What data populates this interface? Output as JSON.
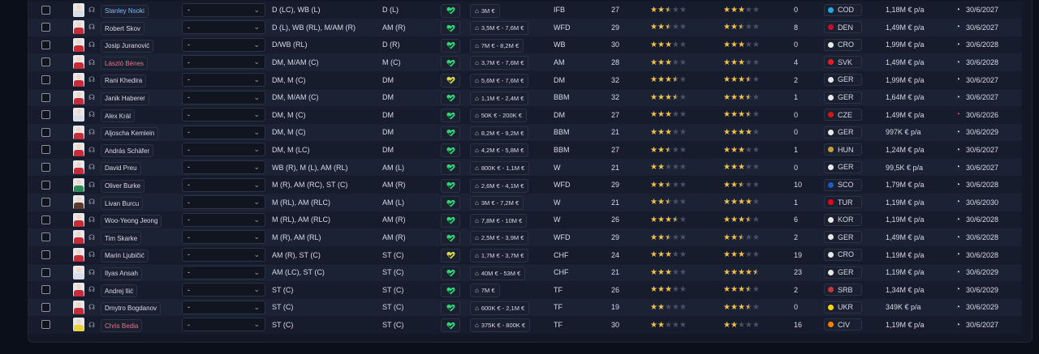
{
  "colors": {
    "background": "#0b0f1a",
    "panel": "#131826",
    "star": "#f2c14e",
    "heart": "#2ed573",
    "heart_alt": "#d6d94a",
    "contract_warning": "#e34a57"
  },
  "icons": {
    "agent": "headset-icon",
    "value": "price-tag-icon",
    "interest": "heart-icon",
    "contract": "clock-icon",
    "selection": "checkbox",
    "dropdown": "chevron-down-icon"
  },
  "rows": [
    {
      "name": "Stanley Nsoki",
      "name_color": "blue",
      "shirt": "#d8dde6",
      "select": "-",
      "positions": "D (LC), WB (L)",
      "position_short": "D (L)",
      "heart": "green",
      "value": "3M €",
      "role": "IFB",
      "age": "27",
      "rating_current": 2.5,
      "rating_potential": 3,
      "apps": "0",
      "nation": "COD",
      "nation_color": "#2aa6e0",
      "wage": "1,18M € p/a",
      "contract": "30/6/2027",
      "contract_warning": false
    },
    {
      "name": "Robert Skov",
      "name_color": "",
      "shirt": "#c92a3a",
      "select": "-",
      "positions": "D (L), WB (RL), M/AM (R)",
      "position_short": "AM (R)",
      "heart": "green",
      "value": "3,5M € - 7,6M €",
      "role": "WFD",
      "age": "29",
      "rating_current": 2.5,
      "rating_potential": 2.5,
      "apps": "8",
      "nation": "DEN",
      "nation_color": "#c8102e",
      "wage": "1,49M € p/a",
      "contract": "30/6/2027",
      "contract_warning": false
    },
    {
      "name": "Josip Juranović",
      "name_color": "",
      "shirt": "#c92a3a",
      "select": "-",
      "positions": "D/WB (RL)",
      "position_short": "D (R)",
      "heart": "green",
      "value": "7M € - 8,2M €",
      "role": "WB",
      "age": "30",
      "rating_current": 3,
      "rating_potential": 3,
      "apps": "0",
      "nation": "CRO",
      "nation_color": "#e8e8e8",
      "wage": "1,99M € p/a",
      "contract": "30/6/2028",
      "contract_warning": false
    },
    {
      "name": "László Bénes",
      "name_color": "red",
      "shirt": "#c92a3a",
      "select": "-",
      "positions": "DM, M/AM (C)",
      "position_short": "M (C)",
      "heart": "green",
      "value": "3,7M € - 7,6M €",
      "role": "AM",
      "age": "28",
      "rating_current": 3,
      "rating_potential": 3,
      "apps": "4",
      "nation": "SVK",
      "nation_color": "#ee1c25",
      "wage": "1,49M € p/a",
      "contract": "30/6/2028",
      "contract_warning": false
    },
    {
      "name": "Rani Khedira",
      "name_color": "",
      "shirt": "#c92a3a",
      "select": "-",
      "positions": "DM, M (C)",
      "position_short": "DM",
      "heart": "yellow",
      "value": "5,6M € - 7,6M €",
      "role": "DM",
      "age": "32",
      "rating_current": 3.5,
      "rating_potential": 3.5,
      "apps": "2",
      "nation": "GER",
      "nation_color": "#e8e8e8",
      "wage": "1,99M € p/a",
      "contract": "30/6/2027",
      "contract_warning": false
    },
    {
      "name": "Janik Haberer",
      "name_color": "",
      "shirt": "#c92a3a",
      "select": "-",
      "positions": "DM, M/AM (C)",
      "position_short": "DM",
      "heart": "green",
      "value": "1,1M € - 2,4M €",
      "role": "BBM",
      "age": "32",
      "rating_current": 3.5,
      "rating_potential": 3.5,
      "apps": "1",
      "nation": "GER",
      "nation_color": "#e8e8e8",
      "wage": "1,64M € p/a",
      "contract": "30/6/2027",
      "contract_warning": false
    },
    {
      "name": "Alex Král",
      "name_color": "",
      "shirt": "#d8dde6",
      "select": "-",
      "positions": "DM, M (C)",
      "position_short": "DM",
      "heart": "green",
      "value": "50K € - 200K €",
      "role": "DM",
      "age": "27",
      "rating_current": 3,
      "rating_potential": 3.5,
      "apps": "0",
      "nation": "CZE",
      "nation_color": "#d7141a",
      "wage": "1,49M € p/a",
      "contract": "30/6/2026",
      "contract_warning": true
    },
    {
      "name": "Aljoscha Kemlein",
      "name_color": "",
      "shirt": "#c92a3a",
      "select": "-",
      "positions": "DM, M (C)",
      "position_short": "DM",
      "heart": "green",
      "value": "8,2M € - 9,2M €",
      "role": "BBM",
      "age": "21",
      "rating_current": 3,
      "rating_potential": 4,
      "apps": "0",
      "nation": "GER",
      "nation_color": "#e8e8e8",
      "wage": "997K € p/a",
      "contract": "30/6/2029",
      "contract_warning": false
    },
    {
      "name": "András Schäfer",
      "name_color": "",
      "shirt": "#c92a3a",
      "select": "-",
      "positions": "DM, M (LC)",
      "position_short": "DM",
      "heart": "green",
      "value": "4,2M € - 5,8M €",
      "role": "BBM",
      "age": "27",
      "rating_current": 2.5,
      "rating_potential": 3,
      "apps": "1",
      "nation": "HUN",
      "nation_color": "#c0a040",
      "wage": "1,24M € p/a",
      "contract": "30/6/2027",
      "contract_warning": false
    },
    {
      "name": "David Preu",
      "name_color": "",
      "shirt": "#c92a3a",
      "select": "-",
      "positions": "WB (R), M (L), AM (RL)",
      "position_short": "AM (L)",
      "heart": "green",
      "value": "800K € - 1,1M €",
      "role": "W",
      "age": "21",
      "rating_current": 2,
      "rating_potential": 3,
      "apps": "0",
      "nation": "GER",
      "nation_color": "#e8e8e8",
      "wage": "99,5K € p/a",
      "contract": "30/6/2027",
      "contract_warning": false
    },
    {
      "name": "Oliver Burke",
      "name_color": "",
      "shirt": "#2d8a5a",
      "select": "-",
      "positions": "M (R), AM (RC), ST (C)",
      "position_short": "AM (R)",
      "heart": "green",
      "value": "2,6M € - 4,1M €",
      "role": "WFD",
      "age": "29",
      "rating_current": 2.5,
      "rating_potential": 2.5,
      "apps": "10",
      "nation": "SCO",
      "nation_color": "#1d5bbf",
      "wage": "1,79M € p/a",
      "contract": "30/6/2028",
      "contract_warning": false
    },
    {
      "name": "Livan Burcu",
      "name_color": "",
      "shirt": "#5a3a2a",
      "select": "-",
      "positions": "M (RL), AM (RLC)",
      "position_short": "AM (L)",
      "heart": "green",
      "value": "3M € - 7,2M €",
      "role": "W",
      "age": "21",
      "rating_current": 2.5,
      "rating_potential": 4,
      "apps": "1",
      "nation": "TUR",
      "nation_color": "#e30a17",
      "wage": "1,19M € p/a",
      "contract": "30/6/2030",
      "contract_warning": false
    },
    {
      "name": "Woo-Yeong Jeong",
      "name_color": "",
      "shirt": "#c92a3a",
      "select": "-",
      "positions": "M (RL), AM (RLC)",
      "position_short": "AM (R)",
      "heart": "green",
      "value": "7,8M € - 10M €",
      "role": "W",
      "age": "26",
      "rating_current": 3.5,
      "rating_potential": 3.5,
      "apps": "6",
      "nation": "KOR",
      "nation_color": "#e8e8e8",
      "wage": "1,19M € p/a",
      "contract": "30/6/2028",
      "contract_warning": false
    },
    {
      "name": "Tim Skarke",
      "name_color": "",
      "shirt": "#c92a3a",
      "select": "-",
      "positions": "M (R), AM (RL)",
      "position_short": "AM (R)",
      "heart": "green",
      "value": "2,5M € - 3,9M €",
      "role": "WFD",
      "age": "29",
      "rating_current": 2.5,
      "rating_potential": 2.5,
      "apps": "2",
      "nation": "GER",
      "nation_color": "#e8e8e8",
      "wage": "1,49M € p/a",
      "contract": "30/6/2028",
      "contract_warning": false
    },
    {
      "name": "Marin Ljubičić",
      "name_color": "",
      "shirt": "#c92a3a",
      "select": "-",
      "positions": "AM (R), ST (C)",
      "position_short": "ST (C)",
      "heart": "yellow",
      "value": "1,7M € - 3,7M €",
      "role": "CHF",
      "age": "24",
      "rating_current": 3,
      "rating_potential": 3,
      "apps": "19",
      "nation": "CRO",
      "nation_color": "#e8e8e8",
      "wage": "1,19M € p/a",
      "contract": "30/6/2028",
      "contract_warning": false
    },
    {
      "name": "Ilyas Ansah",
      "name_color": "",
      "shirt": "#d8dde6",
      "select": "-",
      "positions": "AM (LC), ST (C)",
      "position_short": "ST (C)",
      "heart": "green",
      "value": "40M € - 53M €",
      "role": "CHF",
      "age": "21",
      "rating_current": 3,
      "rating_potential": 4.5,
      "apps": "23",
      "nation": "GER",
      "nation_color": "#e8e8e8",
      "wage": "1,19M € p/a",
      "contract": "30/6/2029",
      "contract_warning": false
    },
    {
      "name": "Andrej Ilić",
      "name_color": "",
      "shirt": "#c92a3a",
      "select": "-",
      "positions": "ST (C)",
      "position_short": "ST (C)",
      "heart": "green",
      "value": "7M €",
      "role": "TF",
      "age": "26",
      "rating_current": 3,
      "rating_potential": 3.5,
      "apps": "2",
      "nation": "SRB",
      "nation_color": "#c6363c",
      "wage": "1,34M € p/a",
      "contract": "30/6/2029",
      "contract_warning": false
    },
    {
      "name": "Dmytro Bogdanov",
      "name_color": "",
      "shirt": "#c92a3a",
      "select": "-",
      "positions": "ST (C)",
      "position_short": "ST (C)",
      "heart": "green",
      "value": "600K € - 2,1M €",
      "role": "TF",
      "age": "19",
      "rating_current": 2,
      "rating_potential": 3.5,
      "apps": "0",
      "nation": "UKR",
      "nation_color": "#ffd500",
      "wage": "349K € p/a",
      "contract": "30/6/2029",
      "contract_warning": false
    },
    {
      "name": "Chris Bedia",
      "name_color": "red",
      "shirt": "#e8d23a",
      "select": "-",
      "positions": "ST (C)",
      "position_short": "ST (C)",
      "heart": "green",
      "value": "375K € - 800K €",
      "role": "TF",
      "age": "30",
      "rating_current": 2,
      "rating_potential": 2,
      "apps": "16",
      "nation": "CIV",
      "nation_color": "#f77f00",
      "wage": "1,19M € p/a",
      "contract": "30/6/2027",
      "contract_warning": false
    }
  ]
}
